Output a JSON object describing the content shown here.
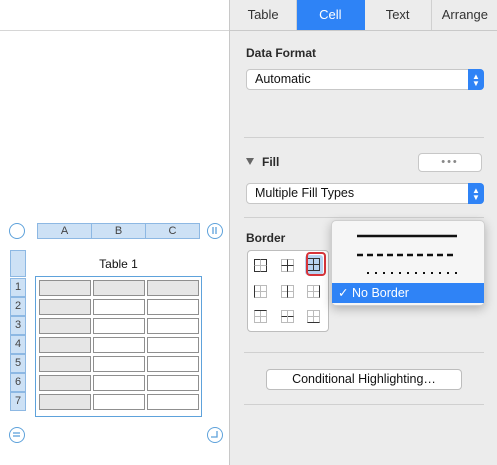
{
  "tabs": [
    {
      "label": "Table",
      "active": false
    },
    {
      "label": "Cell",
      "active": true
    },
    {
      "label": "Text",
      "active": false
    },
    {
      "label": "Arrange",
      "active": false
    }
  ],
  "data_format": {
    "title": "Data Format",
    "value": "Automatic"
  },
  "fill": {
    "title": "Fill",
    "value": "Multiple Fill Types",
    "more_button": "•••"
  },
  "border": {
    "title": "Border",
    "style_menu": {
      "options": [
        "solid-line",
        "dashed-line",
        "dotted-line"
      ],
      "selected": "No Border",
      "checkmark": "✓"
    }
  },
  "conditional_button": "Conditional Highlighting…",
  "table": {
    "title": "Table 1",
    "columns": [
      "A",
      "B",
      "C"
    ],
    "rows": [
      "1",
      "2",
      "3",
      "4",
      "5",
      "6",
      "7"
    ],
    "colors": {
      "header_fill": "#cde1f5",
      "selection": "#5ea2db",
      "cell_gray": "#e6e6e6"
    }
  },
  "colors": {
    "accent": "#2f83f6",
    "highlight_ring": "#d7343a"
  }
}
